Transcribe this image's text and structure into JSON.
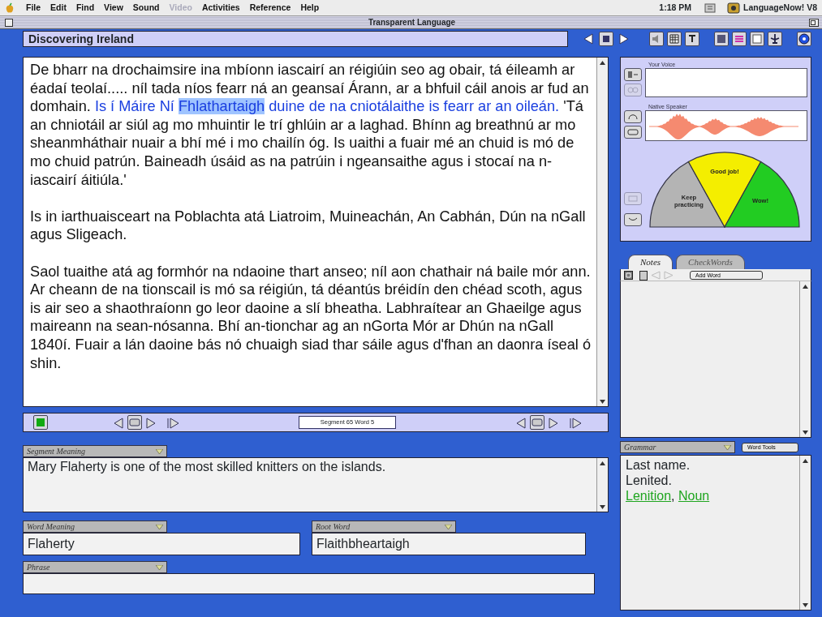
{
  "menu_bar": {
    "items": [
      {
        "label": "File",
        "disabled": false
      },
      {
        "label": "Edit",
        "disabled": false
      },
      {
        "label": "Find",
        "disabled": false
      },
      {
        "label": "View",
        "disabled": false
      },
      {
        "label": "Sound",
        "disabled": false
      },
      {
        "label": "Video",
        "disabled": true
      },
      {
        "label": "Activities",
        "disabled": false
      },
      {
        "label": "Reference",
        "disabled": false
      },
      {
        "label": "Help",
        "disabled": false
      }
    ],
    "clock": "1:18 PM",
    "app": "LanguageNow! V8"
  },
  "window": {
    "title": "Transparent Language"
  },
  "lesson_title": "Discovering Ireland",
  "passage": {
    "paragraphs": [
      {
        "segments": [
          {
            "text": "De bharr na drochaimsire ina mbíonn iascairí an réigiúin seo ag obair, tá éileamh ar éadaí teolaí..... níl tada níos fearr ná an geansaí Árann, ar a bhfuil cáil anois ar fud an domhain.",
            "current": false,
            "selected": false
          },
          {
            "text": "Is í Máire Ní",
            "current": true,
            "selected": false
          },
          {
            "text": "Fhlathartaigh",
            "current": true,
            "selected": true
          },
          {
            "text": "duine de na cniotálaithe is fearr ar an oileán.",
            "current": true,
            "selected": false
          },
          {
            "text": "'Tá an chniotáil ar siúl ag mo mhuintir le trí ghlúin ar a laghad. Bhínn ag breathnú ar mo sheanmháthair nuair a bhí mé i mo chailín óg. Is uaithi a fuair mé an chuid is mó de mo chuid patrún. Baineadh úsáid as na patrúin i ngeansaithe agus i stocaí na n-iascairí áitiúla.'",
            "current": false,
            "selected": false
          }
        ]
      },
      {
        "segments": [
          {
            "text": "Is in iarthuaisceart na Poblachta atá Liatroim, Muineachán, An Cabhán, Dún na nGall agus Sligeach.",
            "current": false,
            "selected": false
          }
        ]
      },
      {
        "segments": [
          {
            "text": "Saol tuaithe atá ag formhór na ndaoine thart anseo; níl aon chathair ná baile mór ann. Ar cheann de na tionscail is mó sa réigiún, tá déantús bréidín den chéad scoth, agus is air seo a shaothraíonn go leor daoine a slí bheatha. Labhraítear an Ghaeilge agus maireann na sean-nósanna. Bhí an-tionchar ag an nGorta Mór ar Dhún na nGall 1840í. Fuair a lán daoine bás nó chuaigh siad thar sáile agus d'fhan an daonra íseal ó shin.",
            "current": false,
            "selected": false
          }
        ]
      }
    ]
  },
  "navigator": {
    "position": "Segment 65  Word 5"
  },
  "segment_meaning": {
    "label": "Segment Meaning",
    "value": "Mary Flaherty is one of the most skilled knitters on the islands."
  },
  "word_meaning": {
    "label": "Word Meaning",
    "value": "Flaherty"
  },
  "root_word": {
    "label": "Root Word",
    "value": "Flaithbheartaigh"
  },
  "phrase": {
    "label": "Phrase"
  },
  "voice_panel": {
    "your_voice_label": "Your Voice",
    "native_speaker_label": "Native Speaker",
    "meter": {
      "zones": [
        {
          "label": "Keep practicing",
          "color": "#b4b4b4"
        },
        {
          "label": "Good job!",
          "color": "#f4ee00"
        },
        {
          "label": "Wow!",
          "color": "#22cc22"
        }
      ]
    }
  },
  "notes_tabs": [
    {
      "label": "Notes",
      "selected": true
    },
    {
      "label": "CheckWords",
      "selected": false
    }
  ],
  "add_word_button": "Add Word",
  "grammar": {
    "tabs": [
      {
        "label": "Grammar",
        "selected": true
      },
      {
        "label": "Word Tools",
        "selected": false
      }
    ],
    "lines": [
      "Last name.",
      "Lenited."
    ],
    "links": [
      "Lenition",
      "Noun"
    ],
    "link_separator": ","
  }
}
